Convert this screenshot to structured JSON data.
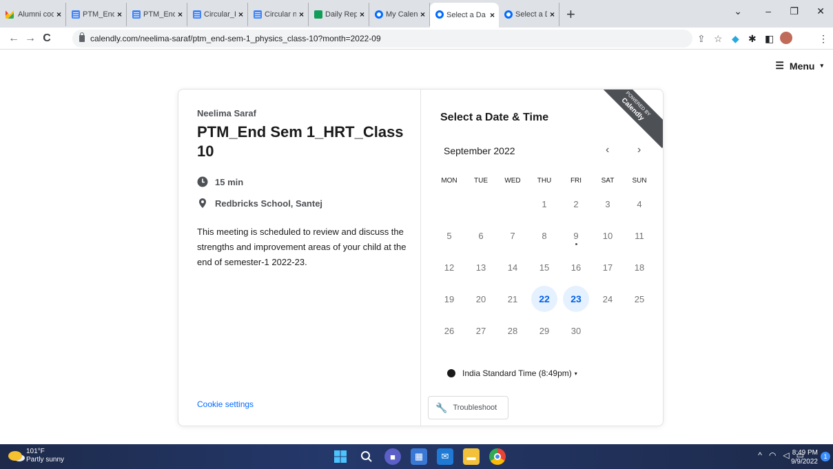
{
  "browser": {
    "tabs": [
      {
        "label": "Alumni coo",
        "favicon": "gmail-icon"
      },
      {
        "label": "PTM_End",
        "favicon": "docs-icon"
      },
      {
        "label": "PTM_End",
        "favicon": "docs-icon"
      },
      {
        "label": "Circular_Re",
        "favicon": "docs-icon"
      },
      {
        "label": "Circular no",
        "favicon": "docs-icon"
      },
      {
        "label": "Daily Repo",
        "favicon": "sheets-icon"
      },
      {
        "label": "My Calend",
        "favicon": "calendly-icon"
      },
      {
        "label": "Select a Da",
        "favicon": "calendly-icon",
        "active": true
      },
      {
        "label": "Select a Da",
        "favicon": "calendly-icon"
      }
    ],
    "tab_close": "×",
    "new_tab": "+",
    "url": "calendly.com/neelima-saraf/ptm_end-sem-1_physics_class-10?month=2022-09"
  },
  "page": {
    "menu_label": "Menu",
    "host_name": "Neelima Saraf",
    "event_title": "PTM_End Sem 1_HRT_Class 10",
    "duration": "15 min",
    "location": "Redbricks School, Santej",
    "description": "This meeting is scheduled to review and discuss the strengths and improvement areas of your child at the end of semester-1 2022-23.",
    "cookie_settings": "Cookie settings",
    "select_title": "Select a Date & Time",
    "month": "September 2022",
    "ribbon_top": "POWERED BY",
    "ribbon_brand": "Calendly",
    "weekdays": [
      "MON",
      "TUE",
      "WED",
      "THU",
      "FRI",
      "SAT",
      "SUN"
    ],
    "days": [
      "",
      "",
      "",
      "1",
      "2",
      "3",
      "4",
      "5",
      "6",
      "7",
      "8",
      "9",
      "10",
      "11",
      "12",
      "13",
      "14",
      "15",
      "16",
      "17",
      "18",
      "19",
      "20",
      "21",
      "22",
      "23",
      "24",
      "25",
      "26",
      "27",
      "28",
      "29",
      "30"
    ],
    "available_days": [
      "22",
      "23"
    ],
    "today": "9",
    "timezone": "India Standard Time (8:49pm)",
    "troubleshoot": "Troubleshoot",
    "accent_color": "#006bff"
  },
  "taskbar": {
    "temperature": "101°F",
    "weather": "Partly sunny",
    "time": "8:49 PM",
    "date": "9/9/2022",
    "notifications": "1"
  }
}
